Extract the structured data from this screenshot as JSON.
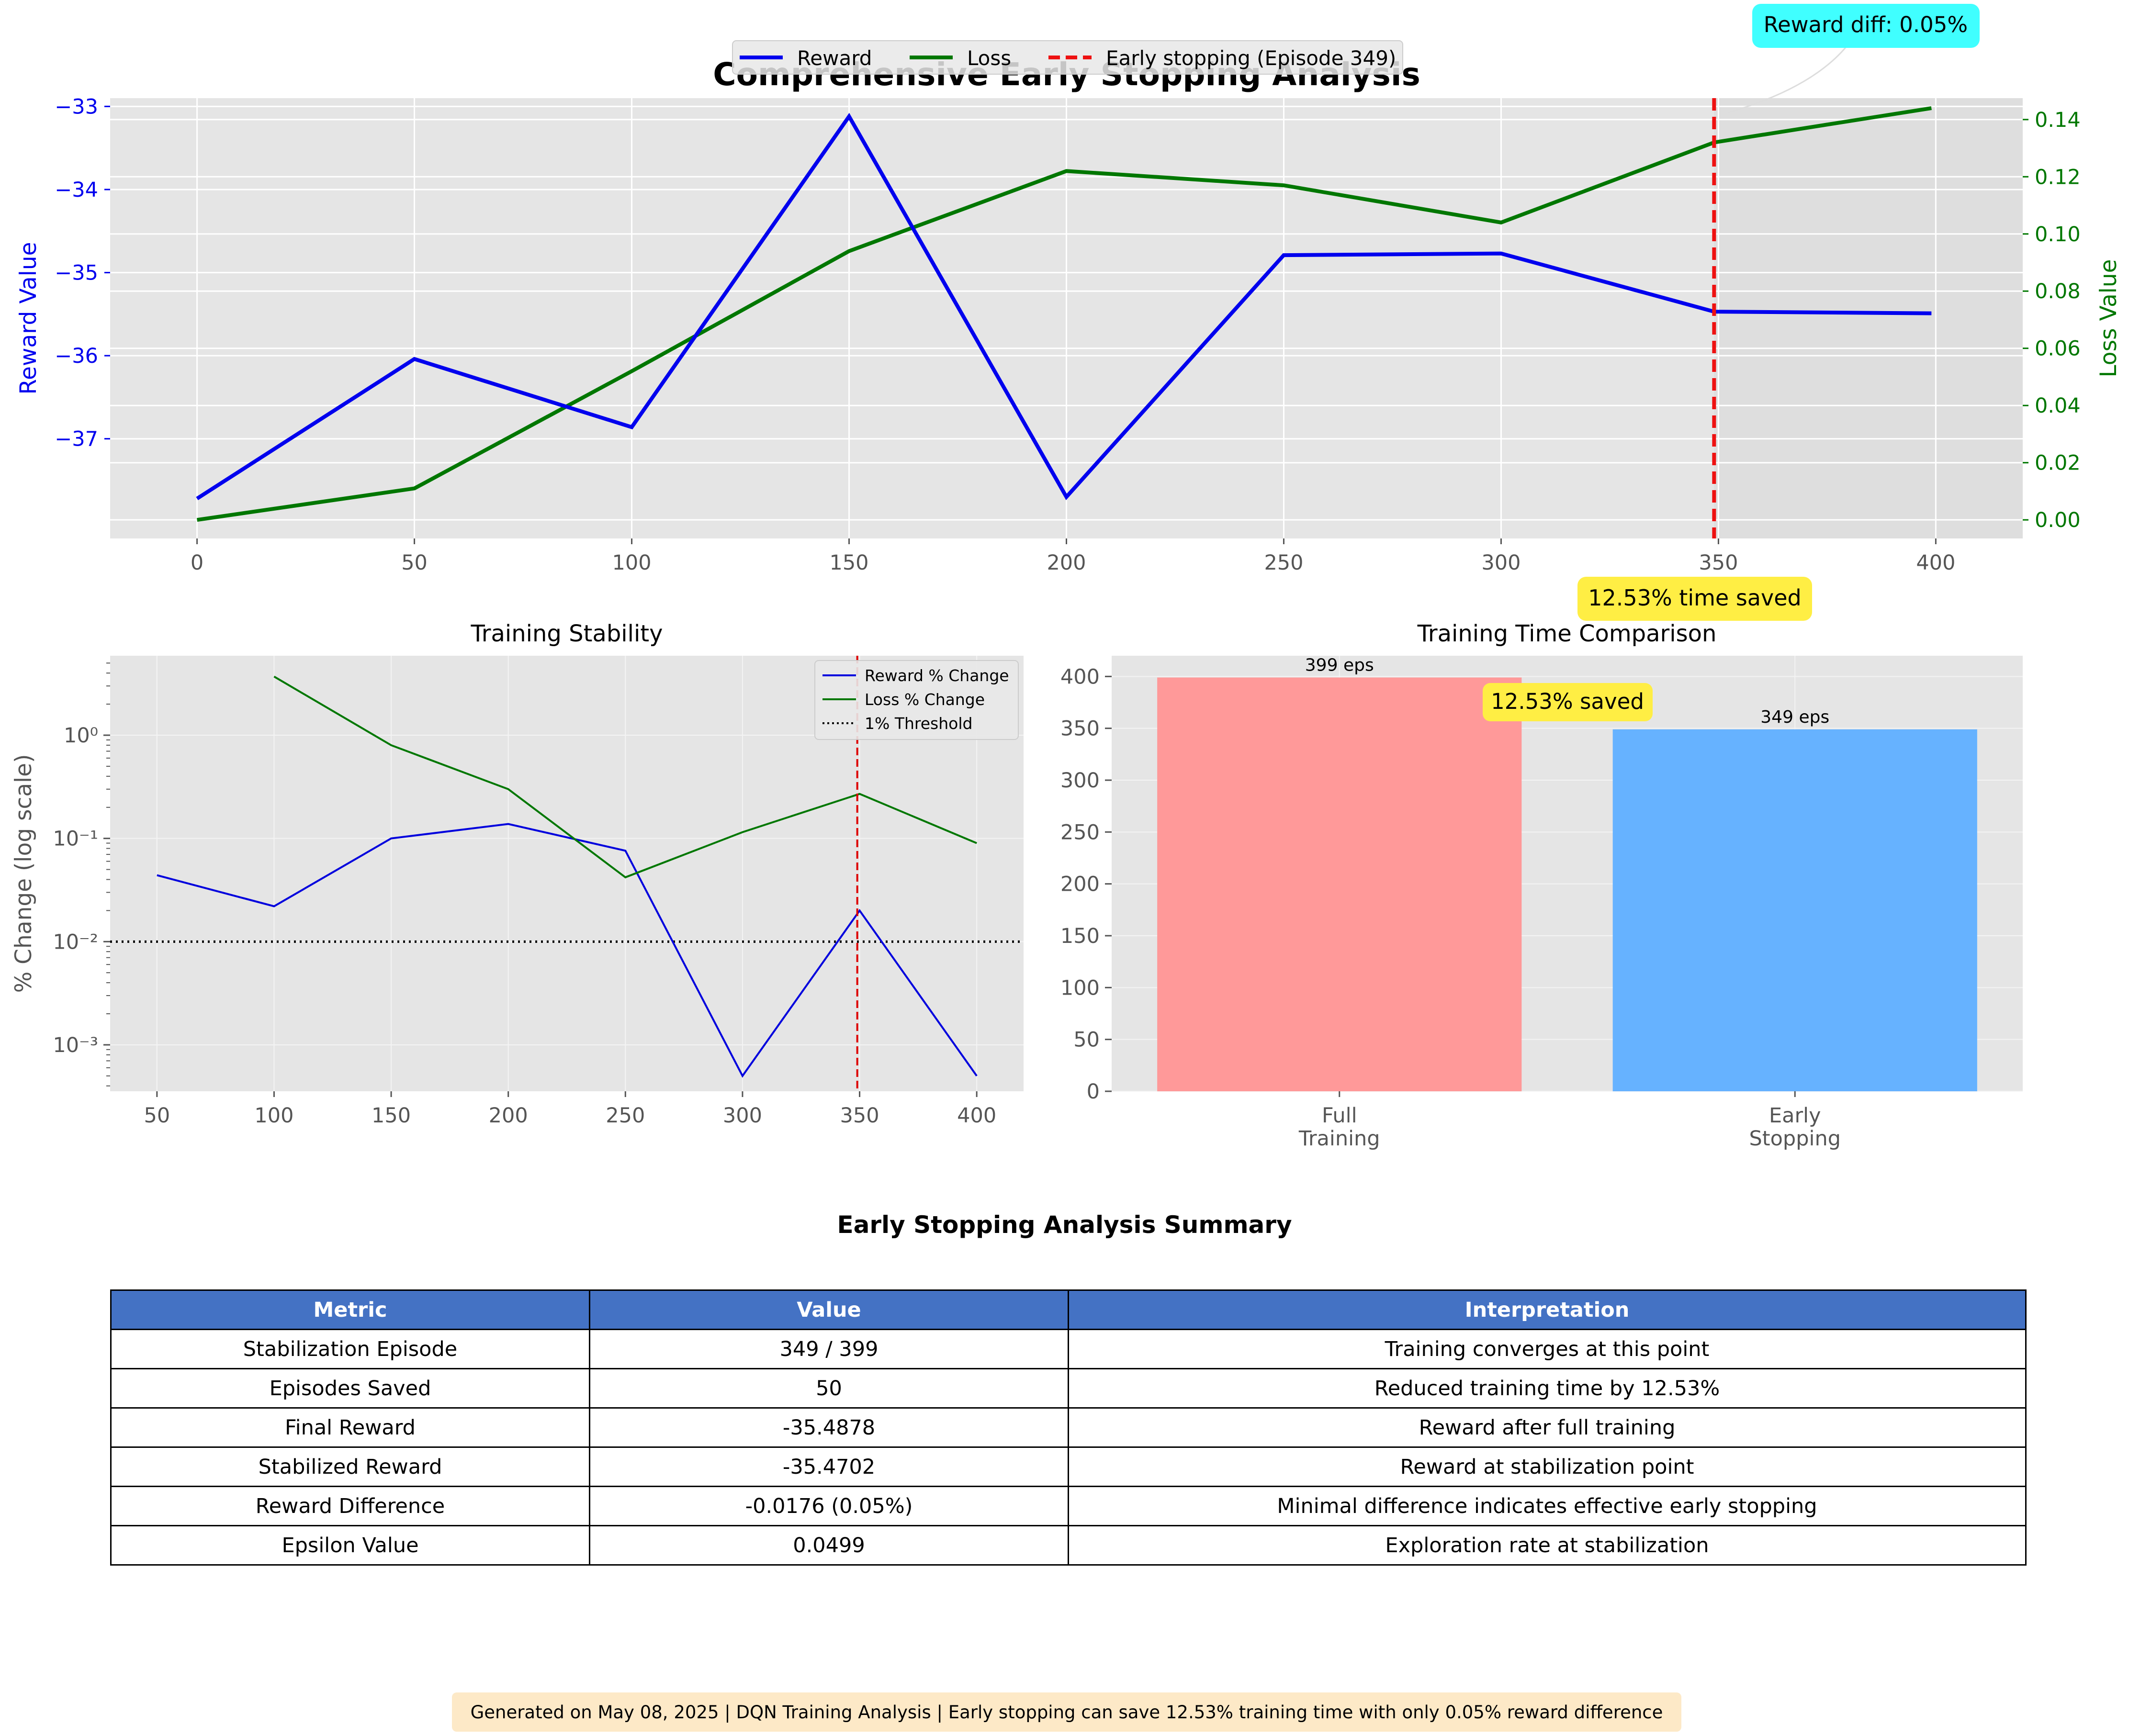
{
  "chart_data": [
    {
      "type": "line",
      "title": "Comprehensive Early Stopping Analysis",
      "ylabel": "Reward Value",
      "y2label": "Loss Value",
      "xlim": [
        -20,
        420
      ],
      "ylim": [
        -38.2,
        -32.9
      ],
      "y2lim": [
        -0.0065,
        0.1475
      ],
      "xticks": [
        0,
        50,
        100,
        150,
        200,
        250,
        300,
        350,
        400
      ],
      "yticks": [
        -37,
        -36,
        -35,
        -34,
        -33
      ],
      "y2ticks": [
        0.0,
        0.02,
        0.04,
        0.06,
        0.08,
        0.1,
        0.12,
        0.14
      ],
      "grid": true,
      "legend_position": "top-center",
      "x": [
        0,
        50,
        100,
        150,
        200,
        250,
        300,
        349,
        399
      ],
      "series": [
        {
          "name": "Reward",
          "axis": "left",
          "color": "#0000ee",
          "values": [
            -37.72,
            -36.04,
            -36.86,
            -33.12,
            -37.7,
            -34.79,
            -34.77,
            -35.47,
            -35.49
          ]
        },
        {
          "name": "Loss",
          "axis": "right",
          "color": "#007700",
          "values": [
            0.0,
            0.011,
            0.052,
            0.094,
            0.122,
            0.117,
            0.104,
            0.132,
            0.144
          ]
        }
      ],
      "vline": {
        "name": "Early stopping (Episode 349)",
        "x": 349,
        "color": "#ee1111"
      },
      "annotations": [
        {
          "text": "Reward diff: 0.05%",
          "color": "#40ffff"
        },
        {
          "text": "12.53% time saved",
          "color": "#ffee44"
        }
      ]
    },
    {
      "type": "line",
      "title": "Training Stability",
      "ylabel": "% Change (log scale)",
      "yscale": "log",
      "xlim": [
        30,
        420
      ],
      "ylim_log10": [
        -3.45,
        0.77
      ],
      "xticks": [
        50,
        100,
        150,
        200,
        250,
        300,
        350,
        400
      ],
      "yticks_log10": [
        -3,
        -2,
        -1,
        0
      ],
      "legend_position": "top-right",
      "series": [
        {
          "name": "Reward % Change",
          "color": "#0000dd",
          "x": [
            50,
            100,
            150,
            200,
            250,
            300,
            350,
            400
          ],
          "values": [
            0.044,
            0.022,
            0.1,
            0.138,
            0.076,
            0.0005,
            0.02,
            0.0005
          ]
        },
        {
          "name": "Loss % Change",
          "color": "#007700",
          "x": [
            100,
            150,
            200,
            250,
            300,
            350,
            400
          ],
          "values": [
            3.7,
            0.8,
            0.3,
            0.042,
            0.115,
            0.27,
            0.09
          ]
        },
        {
          "name": "1% Threshold",
          "color": "#000000",
          "style": "dotted",
          "constant": 0.01
        }
      ],
      "vline": {
        "x": 349,
        "color": "#dd0000"
      }
    },
    {
      "type": "bar",
      "title": "Training Time Comparison",
      "categories": [
        "Full\nTraining",
        "Early\nStopping"
      ],
      "values": [
        399,
        349
      ],
      "colors": [
        "#ff9999",
        "#66b2ff"
      ],
      "data_labels": [
        "399 eps",
        "349 eps"
      ],
      "ylim": [
        0,
        420
      ],
      "yticks": [
        0,
        50,
        100,
        150,
        200,
        250,
        300,
        350,
        400
      ],
      "annotation": {
        "text": "12.53% saved",
        "color": "#ffee44"
      }
    }
  ],
  "summary": {
    "title": "Early Stopping Analysis Summary",
    "columns": [
      "Metric",
      "Value",
      "Interpretation"
    ],
    "rows": [
      [
        "Stabilization Episode",
        "349 / 399",
        "Training converges at this point"
      ],
      [
        "Episodes Saved",
        "50",
        "Reduced training time by 12.53%"
      ],
      [
        "Final Reward",
        "-35.4878",
        "Reward after full training"
      ],
      [
        "Stabilized Reward",
        "-35.4702",
        "Reward at stabilization point"
      ],
      [
        "Reward Difference",
        "-0.0176 (0.05%)",
        "Minimal difference indicates effective early stopping"
      ],
      [
        "Epsilon Value",
        "0.0499",
        "Exploration rate at stabilization"
      ]
    ]
  },
  "footer": "Generated on May 08, 2025 | DQN Training Analysis | Early stopping can save 12.53% training time with only 0.05% reward difference"
}
